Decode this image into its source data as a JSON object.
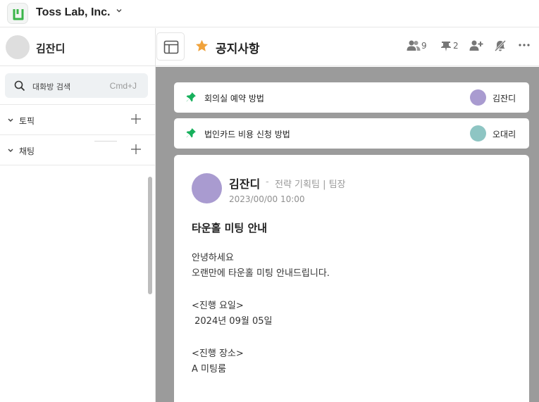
{
  "app": {
    "team_name": "Toss Lab, Inc.",
    "logo_icon": "jandi-logo-icon",
    "accent_color": "#3bb54a"
  },
  "sidebar": {
    "user_name": "김잔디",
    "search": {
      "placeholder": "대화방 검색",
      "shortcut": "Cmd+J"
    },
    "sections": [
      {
        "label": "토픽",
        "icon": "chevron-down-icon",
        "action_icon": "plus-icon"
      },
      {
        "label": "채팅",
        "icon": "chevron-down-icon",
        "action_icon": "plus-icon"
      }
    ]
  },
  "header": {
    "room_title": "공지사항",
    "star_color": "#f0a23b",
    "members_count": "9",
    "pins_count": "2",
    "icons": [
      "panel-toggle-icon",
      "star-icon",
      "members-icon",
      "pin-icon",
      "invite-member-icon",
      "notification-off-icon",
      "more-icon"
    ]
  },
  "pinned": [
    {
      "title": "회의실 예약 방법",
      "author": "김잔디",
      "avatar_color": "#a99bd0"
    },
    {
      "title": "법인카드 비용 신청 방법",
      "author": "오대리",
      "avatar_color": "#8ec5c3"
    }
  ],
  "post": {
    "author": "김잔디",
    "separator": "-",
    "department": "전략 기획팀 | 팀장",
    "date": "2023/00/00 10:00",
    "title": "타운홀 미팅 안내",
    "body": [
      "안녕하세요",
      "오랜만에 타운홀 미팅 안내드립니다.",
      "<진행 요일>",
      " 2024년 09월 05일",
      "<진행 장소>",
      "A 미팅룸"
    ]
  }
}
